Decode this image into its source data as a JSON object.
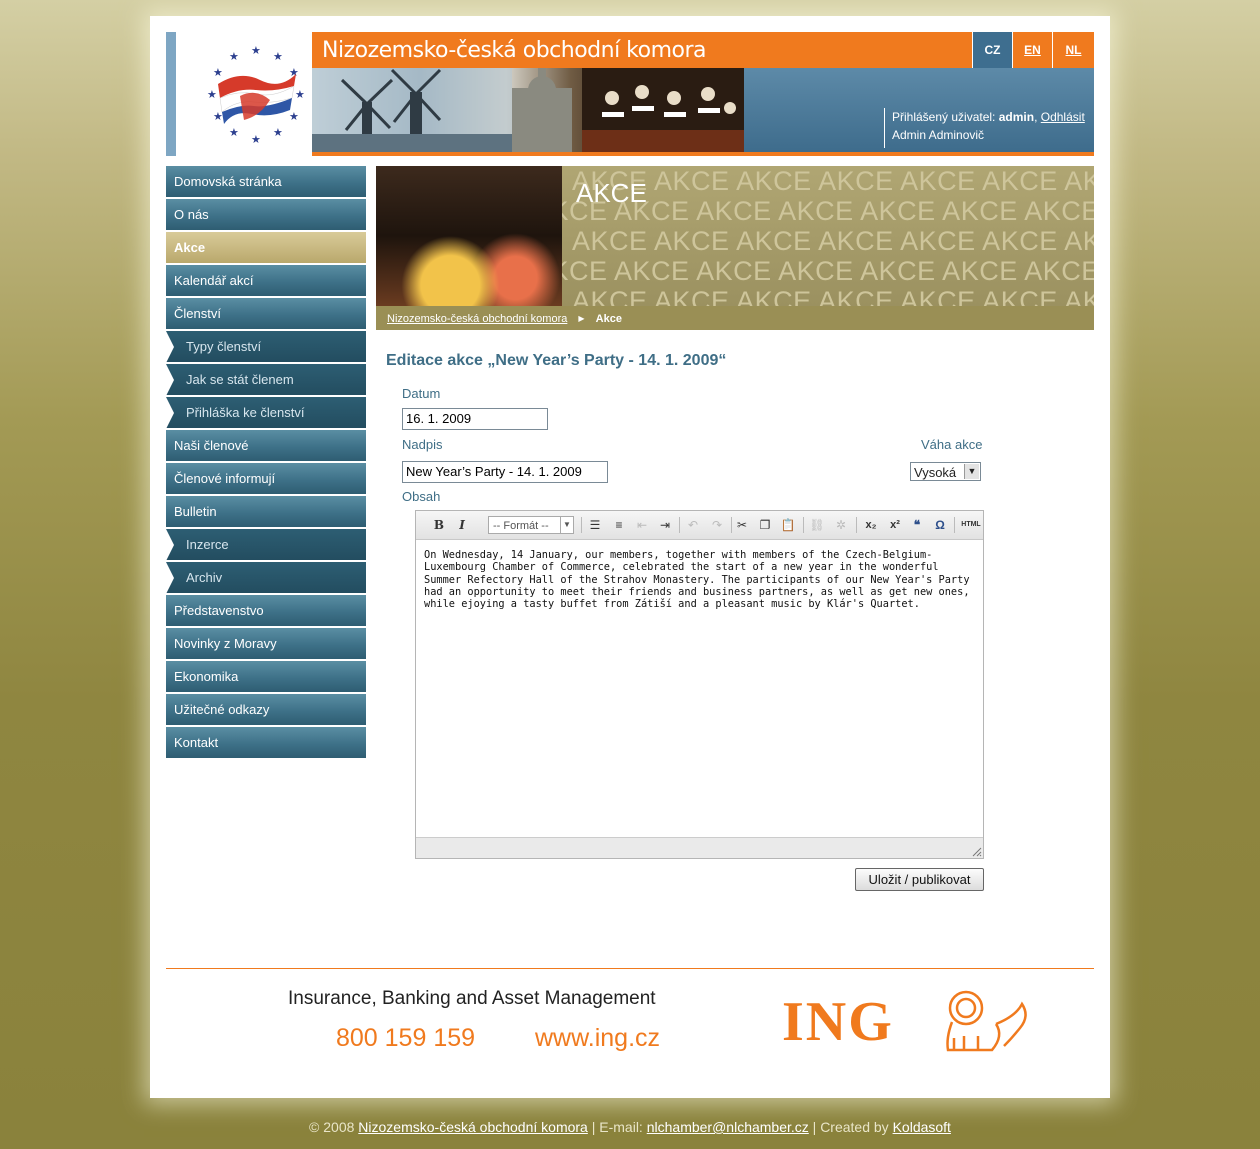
{
  "header": {
    "title": "Nizozemsko-česká obchodní komora",
    "languages": [
      "CZ",
      "EN",
      "NL"
    ],
    "user": {
      "label": "Přihlášený uživatel:",
      "name": "admin",
      "logout": "Odhlásit",
      "full_name": "Admin Adminovič"
    }
  },
  "sidebar": {
    "items": [
      {
        "label": "Domovská stránka"
      },
      {
        "label": "O nás"
      },
      {
        "label": "Akce"
      },
      {
        "label": "Kalendář akcí"
      },
      {
        "label": "Členství"
      },
      {
        "label": "Typy členství"
      },
      {
        "label": "Jak se stát členem"
      },
      {
        "label": "Přihláška ke členství"
      },
      {
        "label": "Naši členové"
      },
      {
        "label": "Členové informují"
      },
      {
        "label": "Bulletin"
      },
      {
        "label": "Inzerce"
      },
      {
        "label": "Archiv"
      },
      {
        "label": "Představenstvo"
      },
      {
        "label": "Novinky z Moravy"
      },
      {
        "label": "Ekonomika"
      },
      {
        "label": "Užitečné odkazy"
      },
      {
        "label": "Kontakt"
      }
    ]
  },
  "section": {
    "title": "AKCE",
    "pattern_word": "AKCE",
    "breadcrumb": {
      "home": "Nizozemsko-česká obchodní komora",
      "current": "Akce"
    }
  },
  "form": {
    "title": "Editace akce „New Year’s Party - 14. 1. 2009“",
    "datum_label": "Datum",
    "datum_value": "16. 1. 2009",
    "nadpis_label": "Nadpis",
    "nadpis_value": "New Year’s Party - 14. 1. 2009",
    "vaha_label": "Váha akce",
    "vaha_value": "Vysoká",
    "obsah_label": "Obsah",
    "format_placeholder": "-- Formát --",
    "content": "On Wednesday, 14 January, our members, together with members of the Czech-Belgium-Luxembourg Chamber of Commerce, celebrated the start of a new year in the wonderful Summer Refectory Hall of the Strahov Monastery. The participants of our New Year's Party had an opportunity to meet their friends and business partners, as well as get new ones, while ejoying a tasty buffet from Zátiší and a pleasant music by Klár's Quartet.",
    "submit": "Uložit / publikovat"
  },
  "ad": {
    "tagline": "Insurance, Banking and Asset Management",
    "phone": "800 159 159",
    "web": "www.ing.cz",
    "brand": "ING"
  },
  "footer": {
    "copyright": "© 2008",
    "org": "Nizozemsko-česká obchodní komora",
    "email_label": "| E-mail:",
    "email": "nlchamber@nlchamber.cz",
    "created_label": "| Created by",
    "creator": "Koldasoft"
  },
  "colors": {
    "accent": "#f07a1e",
    "nav_blue": "#3e7188",
    "title_blue": "#3f6e86",
    "olive_bg": "#8f8640"
  }
}
